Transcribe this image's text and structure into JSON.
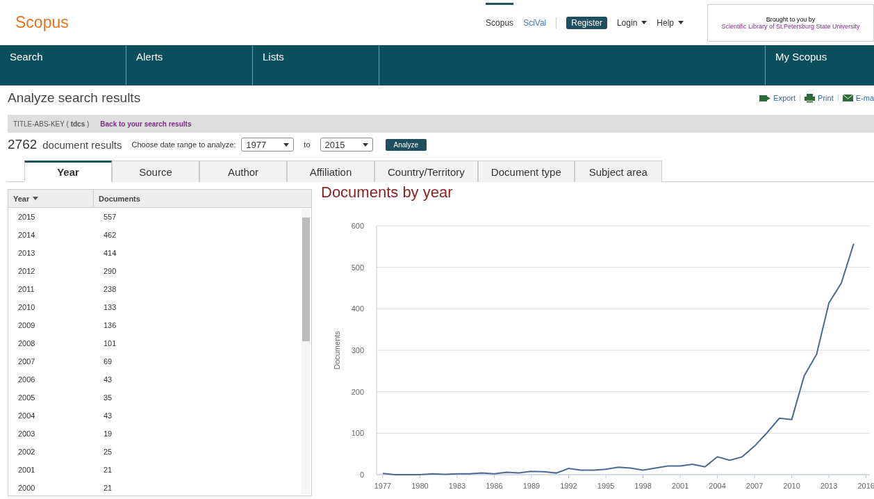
{
  "logo": "Scopus",
  "top_links": [
    {
      "label": "Scopus",
      "selected": true,
      "kind": "plain"
    },
    {
      "label": "SciVal",
      "selected": false,
      "kind": "link"
    },
    {
      "label": "Register",
      "selected": false,
      "kind": "button"
    },
    {
      "label": "Login",
      "selected": false,
      "kind": "menu"
    },
    {
      "label": "Help",
      "selected": false,
      "kind": "menu"
    }
  ],
  "institution": {
    "caption": "Brought to you by",
    "name": "Scientific Library of St.Petersburg State University"
  },
  "nav": [
    {
      "label": "Search"
    },
    {
      "label": "Alerts"
    },
    {
      "label": "Lists"
    },
    {
      "kind": "spacer"
    },
    {
      "label": "My Scopus"
    }
  ],
  "page_title": "Analyze search results",
  "actions": [
    {
      "label": "Export",
      "kind": "export"
    },
    {
      "label": "Print",
      "kind": "print"
    },
    {
      "label": "E-ma",
      "kind": "email"
    }
  ],
  "query": {
    "text": "TITLE-ABS-KEY ( **tdcs** )",
    "back_link": "Back to your search results"
  },
  "results": {
    "count": "2762",
    "label": "document results",
    "range_label": "Choose date range to analyze:",
    "from": "1977",
    "to_label": "to",
    "to": "2015",
    "button": "Analyze"
  },
  "tabs": [
    {
      "label": "Year",
      "selected": true
    },
    {
      "label": "Source",
      "selected": false
    },
    {
      "label": "Author",
      "selected": false
    },
    {
      "label": "Affiliation",
      "selected": false
    },
    {
      "label": "Country/Territory",
      "selected": false
    },
    {
      "label": "Document type",
      "selected": false
    },
    {
      "label": "Subject area",
      "selected": false
    }
  ],
  "table": {
    "columns": [
      "Year",
      "Documents"
    ],
    "rows": [
      [
        "2015",
        "557"
      ],
      [
        "2014",
        "462"
      ],
      [
        "2013",
        "414"
      ],
      [
        "2012",
        "290"
      ],
      [
        "2011",
        "238"
      ],
      [
        "2010",
        "133"
      ],
      [
        "2009",
        "136"
      ],
      [
        "2008",
        "101"
      ],
      [
        "2007",
        "69"
      ],
      [
        "2006",
        "43"
      ],
      [
        "2005",
        "35"
      ],
      [
        "2004",
        "43"
      ],
      [
        "2003",
        "19"
      ],
      [
        "2002",
        "25"
      ],
      [
        "2001",
        "21"
      ],
      [
        "2000",
        "21"
      ]
    ]
  },
  "chart_data": {
    "type": "line",
    "title": "Documents by year",
    "ylabel": "Documents",
    "x": [
      1977,
      1978,
      1979,
      1980,
      1981,
      1982,
      1983,
      1984,
      1985,
      1986,
      1987,
      1988,
      1989,
      1990,
      1991,
      1992,
      1993,
      1994,
      1995,
      1996,
      1997,
      1998,
      1999,
      2000,
      2001,
      2002,
      2003,
      2004,
      2005,
      2006,
      2007,
      2008,
      2009,
      2010,
      2011,
      2012,
      2013,
      2014,
      2015
    ],
    "grid": true,
    "series": [
      {
        "color": "#4a6a94",
        "values": [
          3,
          0,
          0,
          0,
          2,
          1,
          2,
          2,
          4,
          2,
          6,
          4,
          8,
          7,
          4,
          15,
          11,
          11,
          13,
          18,
          16,
          11,
          16,
          21,
          21,
          25,
          19,
          43,
          35,
          43,
          69,
          101,
          136,
          133,
          238,
          290,
          414,
          462,
          557
        ]
      }
    ],
    "xlim": [
      1976.5,
      2016.3
    ],
    "ylim": [
      0,
      600
    ],
    "xticks": [
      1977,
      1980,
      1983,
      1986,
      1989,
      1992,
      1995,
      1998,
      2001,
      2004,
      2007,
      2010,
      2013,
      2016
    ],
    "yticks": [
      0,
      100,
      200,
      300,
      400,
      500,
      600
    ]
  }
}
